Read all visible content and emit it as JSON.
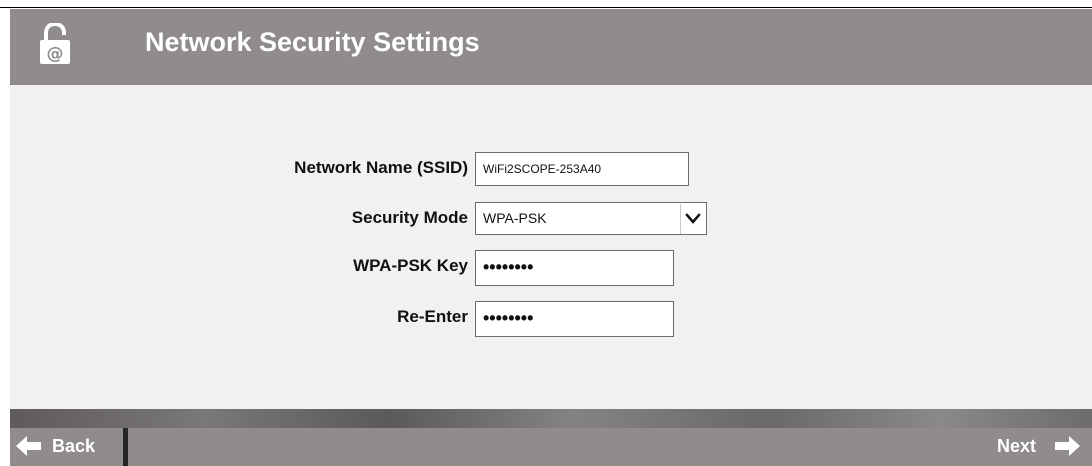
{
  "header": {
    "title": "Network Security Settings",
    "icon": "lock-icon"
  },
  "form": {
    "ssid": {
      "label": "Network Name (SSID)",
      "value": "WiFi2SCOPE-253A40"
    },
    "security_mode": {
      "label": "Security Mode",
      "selected": "WPA-PSK"
    },
    "wpa_psk_key": {
      "label": "WPA-PSK Key",
      "masked_value": "••••••••"
    },
    "re_enter": {
      "label": "Re-Enter",
      "masked_value": "••••••••"
    }
  },
  "footer": {
    "back_label": "Back",
    "next_label": "Next"
  },
  "colors": {
    "header_bg": "#8f8c8b",
    "content_bg": "#f1f1f1",
    "text": "#111111",
    "nav_text": "#ffffff"
  }
}
